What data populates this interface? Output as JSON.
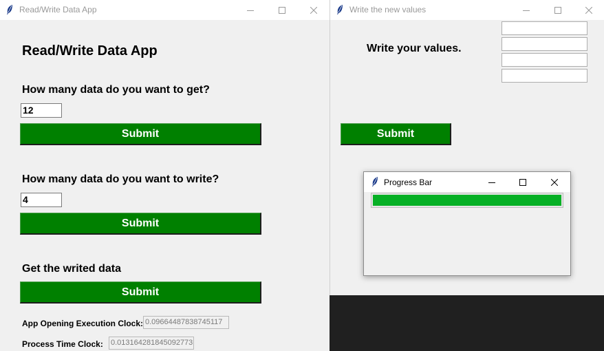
{
  "main_window": {
    "title": "Read/Write Data App",
    "heading": "Read/Write Data App",
    "get_question": "How many data do you want to get?",
    "get_value": "12",
    "get_submit": "Submit",
    "write_question": "How many data do you want to write?",
    "write_value": "4",
    "write_submit": "Submit",
    "read_label": "Get the writed data",
    "read_submit": "Submit",
    "opening_clock_label": "App Opening Execution Clock:",
    "opening_clock_value": "0.09664487838745117",
    "process_clock_label": "Process Time Clock:",
    "process_clock_value": "0.013164281845092773"
  },
  "write_window": {
    "title": "Write the new values",
    "prompt": "Write your values.",
    "entries": [
      "",
      "",
      "",
      ""
    ],
    "submit": "Submit"
  },
  "progress_window": {
    "title": "Progress Bar",
    "progress_percent": 100
  },
  "colors": {
    "button_green": "#008000",
    "progress_green": "#06b025",
    "taskbar_dark": "#202020"
  },
  "icons": {
    "app_icon": "feather-icon",
    "minimize": "minimize-icon",
    "maximize": "maximize-icon",
    "close": "close-icon"
  }
}
